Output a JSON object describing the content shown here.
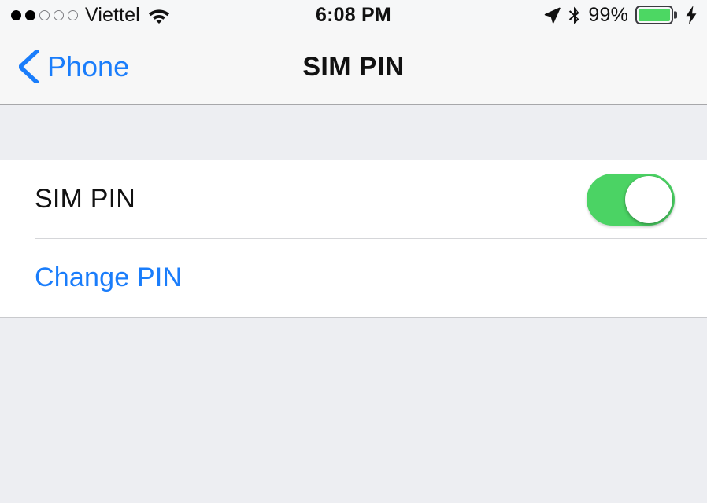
{
  "status_bar": {
    "signal_dots_filled": 2,
    "signal_dots_total": 5,
    "carrier": "Viettel",
    "wifi_icon": "wifi-icon",
    "time": "6:08 PM",
    "location_icon": "location-arrow-icon",
    "bluetooth_icon": "bluetooth-icon",
    "battery_percent": "99%",
    "battery_icon": "battery-icon",
    "charging_icon": "charging-bolt-icon"
  },
  "nav_bar": {
    "back_icon": "chevron-left-icon",
    "back_label": "Phone",
    "title": "SIM PIN"
  },
  "main": {
    "rows": [
      {
        "label": "SIM PIN",
        "type": "toggle",
        "toggle_on": true
      },
      {
        "label": "Change PIN",
        "type": "link"
      }
    ]
  },
  "colors": {
    "accent_blue": "#1a7dfb",
    "toggle_green": "#4bd364",
    "battery_green": "#4cd763",
    "background_gray": "#edeef2",
    "row_background": "#ffffff"
  }
}
